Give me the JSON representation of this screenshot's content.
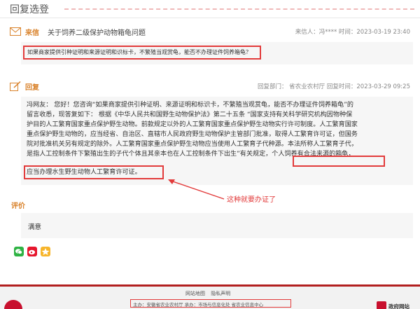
{
  "header": {
    "title": "回复选登"
  },
  "question": {
    "tag": "来信",
    "title": "关于饲养二级保护动物箱龟问题",
    "meta": "来信人：冯****   时间：2023-03-19 23:40",
    "text": "如果商家提供引种证明和来源证明和识标卡，不繁殖当观赏龟，能否不办理证件饲养箱龟？"
  },
  "reply": {
    "tag": "回复",
    "meta": "回复部门：  省农业农村厅   回复时间：2023-03-29 09:25",
    "lines": [
      "冯网友：  您好！您咨询“如果商家提供引种证明、来源证明和标识卡，不繁殖当观赏龟，能否不办理证件饲养箱龟”的",
      "留言收悉，现答复如下：  根据《中华人民共和国野生动物保护法》第二十五条  “国家支持有关科学研究机构因物种保",
      "护目的人工繁育国家重点保护野生动物。前款规定以外的人工繁育国家重点保护野生动物实行许可制度。人工繁育国家",
      "重点保护野生动物的，应当经省、自治区、直辖市人民政府野生动物保护主管部门批准，取得人工繁育许可证，但国务",
      "院对批准机关另有规定的除外。人工繁育国家重点保护野生动物应当使用人工繁育子代种源。本法所称人工繁育子代，",
      "是指人工控制条件下繁殖出生的子代个体且其亲本也在人工控制条件下出生”有关规定，个人饲养有合法来源的箱龟，",
      "应当办理水生野生动物人工繁育许可证。"
    ]
  },
  "annotation": "这种就要办证了",
  "evaluation": {
    "title": "评价",
    "text": "满意"
  },
  "share": [
    "wechat-icon",
    "weibo-icon",
    "qzone-icon"
  ],
  "footer": {
    "links": [
      "网站地图",
      "隐私声明"
    ],
    "host": "主办：安徽省农业农村厅  承办：市场与信息化处  省农业信息中心",
    "gov": "政府网站"
  },
  "colors": {
    "accent": "#d9822b",
    "highlight": "#e23b3b",
    "footer_bar": "#b21f1f"
  }
}
